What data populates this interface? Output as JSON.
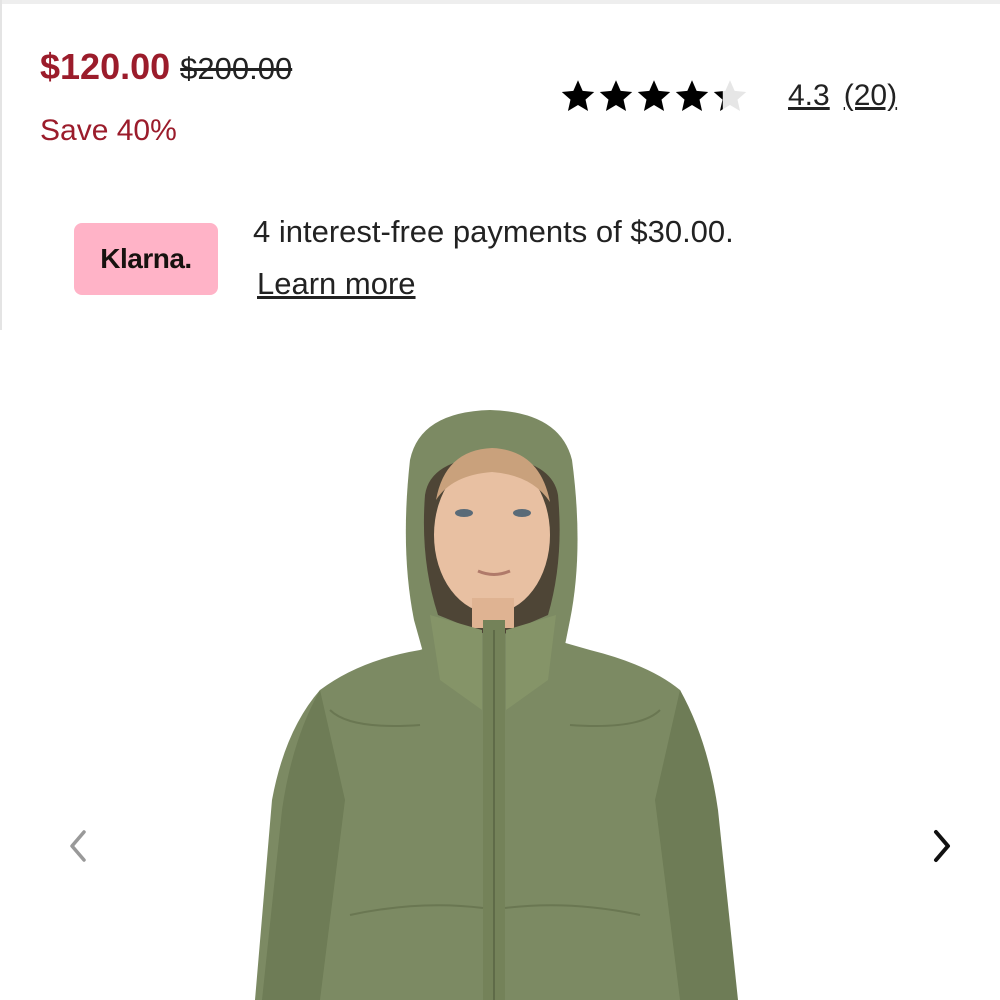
{
  "colors": {
    "sale_red": "#9b1c2b",
    "klarna_pink": "#ffb3c7",
    "star_black": "#000000",
    "star_empty": "#e6e6e6",
    "jacket_green": "#7c8a63"
  },
  "pricing": {
    "sale_price": "$120.00",
    "original_price": "$200.00",
    "savings": "Save 40%"
  },
  "rating": {
    "value": "4.3",
    "reviews": "(20)",
    "stars_filled_fraction": 0.86,
    "stars_total": 5
  },
  "klarna": {
    "logo_text": "Klarna.",
    "message": "4 interest-free payments of $30.00.",
    "link_label": "Learn more"
  },
  "gallery": {
    "image_subject": "woman wearing olive green hooded rain jacket",
    "prev_icon": "chevron-left-icon",
    "next_icon": "chevron-right-icon"
  }
}
